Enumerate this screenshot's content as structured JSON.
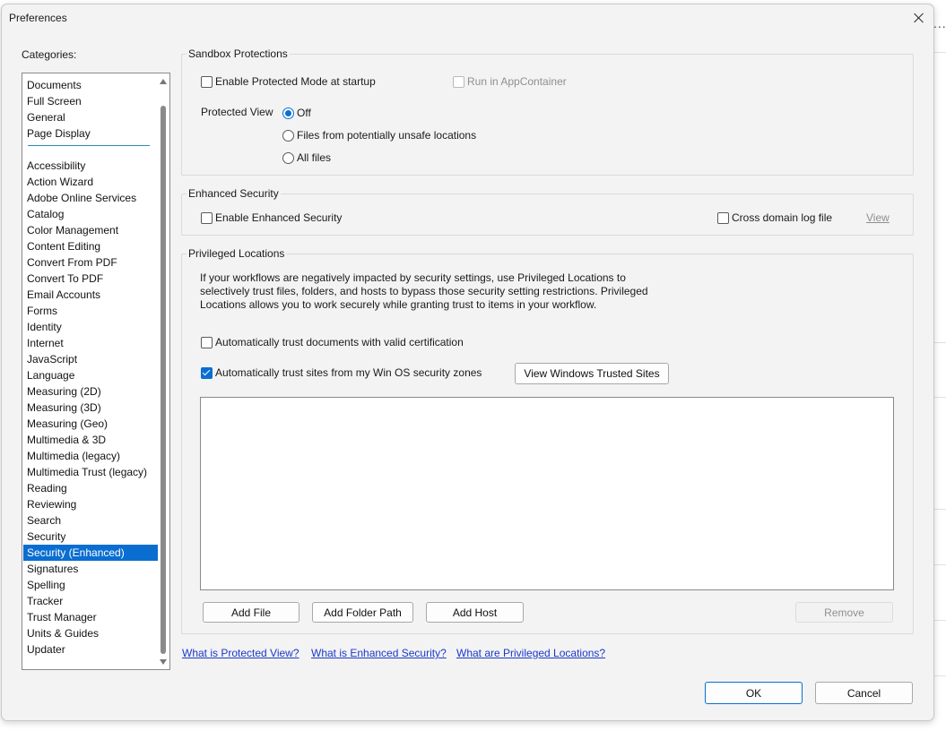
{
  "window": {
    "title": "Preferences"
  },
  "background_app": {
    "dots": "..."
  },
  "categories": {
    "label": "Categories:",
    "top_items": [
      "Documents",
      "Full Screen",
      "General",
      "Page Display"
    ],
    "items": [
      "Accessibility",
      "Action Wizard",
      "Adobe Online Services",
      "Catalog",
      "Color Management",
      "Content Editing",
      "Convert From PDF",
      "Convert To PDF",
      "Email Accounts",
      "Forms",
      "Identity",
      "Internet",
      "JavaScript",
      "Language",
      "Measuring (2D)",
      "Measuring (3D)",
      "Measuring (Geo)",
      "Multimedia & 3D",
      "Multimedia (legacy)",
      "Multimedia Trust (legacy)",
      "Reading",
      "Reviewing",
      "Search",
      "Security",
      "Security (Enhanced)",
      "Signatures",
      "Spelling",
      "Tracker",
      "Trust Manager",
      "Units & Guides",
      "Updater"
    ],
    "selected": "Security (Enhanced)"
  },
  "sandbox": {
    "title": "Sandbox Protections",
    "protected_mode_label": "Enable Protected Mode at startup",
    "protected_mode_checked": false,
    "app_container_label": "Run in AppContainer",
    "app_container_enabled": false,
    "protected_view_label": "Protected View",
    "options": [
      "Off",
      "Files from potentially unsafe locations",
      "All files"
    ],
    "selected_option": "Off"
  },
  "enhanced": {
    "title": "Enhanced Security",
    "enable_label": "Enable Enhanced Security",
    "enable_checked": false,
    "cross_domain_label": "Cross domain log file",
    "cross_domain_checked": false,
    "view_link": "View"
  },
  "privileged": {
    "title": "Privileged Locations",
    "description": "If your workflows are negatively impacted by security settings, use Privileged Locations to selectively trust files, folders, and hosts to bypass those security setting restrictions. Privileged Locations allows you to work securely while granting trust to items in your workflow.",
    "trust_cert_label": "Automatically trust documents with valid certification",
    "trust_cert_checked": false,
    "trust_sites_label": "Automatically trust sites from my Win OS security zones",
    "trust_sites_checked": true,
    "view_sites_button": "View Windows Trusted Sites",
    "add_file_button": "Add File",
    "add_folder_button": "Add Folder Path",
    "add_host_button": "Add Host",
    "remove_button": "Remove"
  },
  "help_links": [
    "What is Protected View?",
    "What is Enhanced Security?",
    "What are Privileged Locations?"
  ],
  "footer": {
    "ok_label": "OK",
    "cancel_label": "Cancel"
  },
  "colors": {
    "accent": "#0a6ed1",
    "link": "#1a39c9",
    "dialog_bg": "#f3f3f3"
  }
}
